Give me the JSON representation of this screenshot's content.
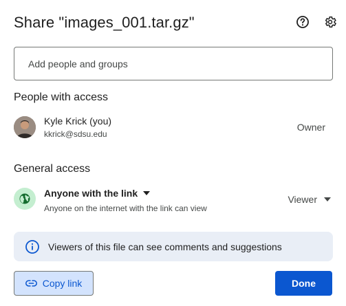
{
  "dialog": {
    "title": "Share \"images_001.tar.gz\"",
    "help_icon": "help-circle-icon",
    "settings_icon": "gear-icon"
  },
  "add_people": {
    "placeholder": "Add people and groups",
    "value": ""
  },
  "people_with_access": {
    "heading": "People with access",
    "users": [
      {
        "name": "Kyle Krick (you)",
        "email": "kkrick@sdsu.edu",
        "role": "Owner"
      }
    ]
  },
  "general_access": {
    "heading": "General access",
    "selected_option": "Anyone with the link",
    "description": "Anyone on the internet with the link can view",
    "role": "Viewer",
    "icon": "globe-icon",
    "icon_bg": "#c4eed0",
    "icon_color": "#146c2e"
  },
  "info_banner": {
    "text": "Viewers of this file can see comments and suggestions",
    "icon": "info-icon",
    "bg": "#e9eef6"
  },
  "footer": {
    "copy_link_label": "Copy link",
    "copy_link_icon": "link-icon",
    "done_label": "Done",
    "accent": "#0b57d0"
  }
}
